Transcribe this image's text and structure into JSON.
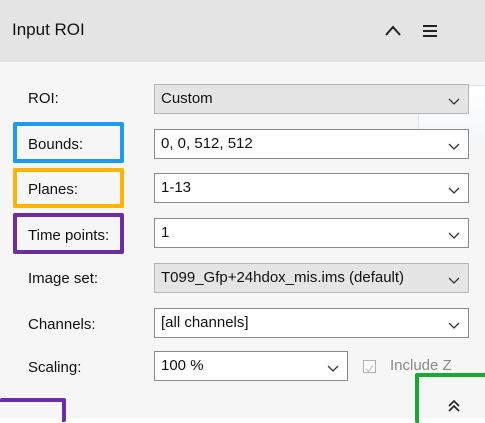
{
  "header": {
    "title": "Input ROI",
    "collapse_icon": "chevron-up-icon",
    "menu_icon": "hamburger-menu-icon"
  },
  "rows": {
    "roi": {
      "label": "ROI:",
      "value": "Custom"
    },
    "bounds": {
      "label": "Bounds:",
      "value": "0, 0, 512, 512"
    },
    "planes": {
      "label": "Planes:",
      "value": "1-13"
    },
    "timepoints": {
      "label": "Time points:",
      "value": "1"
    },
    "imageset": {
      "label": "Image set:",
      "value": "T099_Gfp+24hdox_mis.ims (default)"
    },
    "channels": {
      "label": "Channels:",
      "value": "[all channels]"
    },
    "scaling": {
      "label": "Scaling:",
      "value": "100 %"
    }
  },
  "include_z": {
    "label": "Include Z",
    "checked": false
  },
  "footer": {
    "expand_icon": "double-chevron-up-icon"
  },
  "colors": {
    "highlight_blue": "#1e9bf0",
    "highlight_orange": "#ffb400",
    "highlight_purple": "#6a2fa0",
    "highlight_green": "#19a832",
    "header_bg": "#e4e4e4",
    "panel_bg": "#f6f6f6"
  }
}
